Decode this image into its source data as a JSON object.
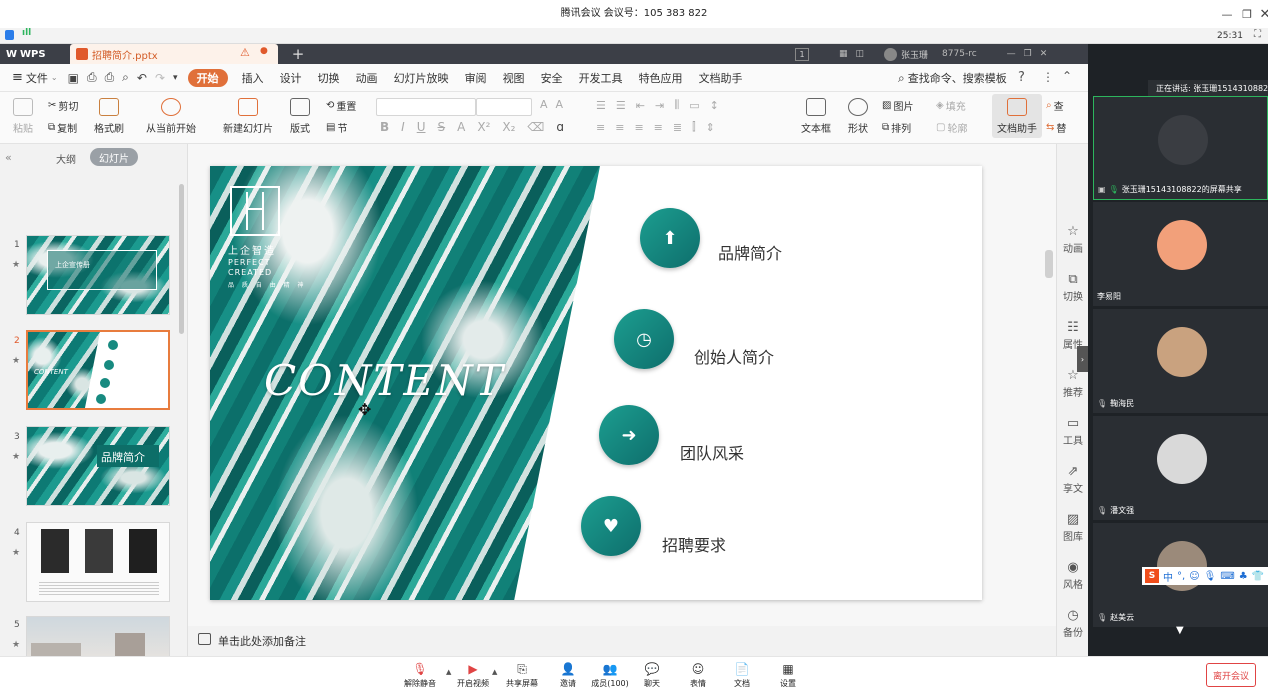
{
  "meeting": {
    "title": "腾讯会议 会议号：105 383 822",
    "signal_text": "ıll",
    "timer": "25:31",
    "speaking": "正在讲话: 张玉珊15143108822",
    "participants": [
      {
        "name": "张玉珊15143108822的屏幕共享",
        "avatar_color": "#3a3d42"
      },
      {
        "name": "李易阳",
        "avatar_color": "#f2a07a"
      },
      {
        "name": "鞠海民",
        "avatar_color": "#c9a27f"
      },
      {
        "name": "潘文强",
        "avatar_color": "#d9d9d9"
      },
      {
        "name": "赵美云",
        "avatar_color": "#9b8a7a"
      }
    ],
    "toolbar": [
      {
        "label": "解除静音",
        "icon": "mic-muted-icon"
      },
      {
        "label": "开启视频",
        "icon": "camera-off-icon"
      },
      {
        "label": "共享屏幕",
        "icon": "share-screen-icon"
      },
      {
        "label": "邀请",
        "icon": "invite-icon"
      },
      {
        "label": "成员(100)",
        "icon": "members-icon"
      },
      {
        "label": "聊天",
        "icon": "chat-icon"
      },
      {
        "label": "表情",
        "icon": "emoji-icon"
      },
      {
        "label": "文档",
        "icon": "document-icon"
      },
      {
        "label": "设置",
        "icon": "settings-icon"
      }
    ],
    "leave_label": "离开会议",
    "ime_label": "中"
  },
  "wps": {
    "app_label": "WPS",
    "doc_tab": "招聘简介.pptx",
    "tabbar_badge": "1",
    "user_label": "张玉珊",
    "user_id": "8775-rc",
    "file_menu": "文件",
    "menus": [
      "开始",
      "插入",
      "设计",
      "切换",
      "动画",
      "幻灯片放映",
      "审阅",
      "视图",
      "安全",
      "开发工具",
      "特色应用",
      "文档助手"
    ],
    "search_label": "查找命令、搜索模板",
    "ribbon": {
      "paste": "粘贴",
      "cut": "剪切",
      "copy": "复制",
      "format_painter": "格式刷",
      "play_from_current": "从当前开始",
      "new_slide": "新建幻灯片",
      "layout": "版式",
      "reset": "重置",
      "section": "节",
      "textbox": "文本框",
      "shape": "形状",
      "picture": "图片",
      "arrange": "排列",
      "fill": "填充",
      "outline": "轮廓",
      "doc_assistant": "文档助手",
      "find": "查",
      "replace": "替"
    },
    "panel": {
      "outline_tab": "大纲",
      "slides_tab": "幻灯片",
      "thumbnails": [
        {
          "num": "1",
          "label": "上企宣传册"
        },
        {
          "num": "2",
          "label": "CONTENT"
        },
        {
          "num": "3",
          "label": "品牌简介"
        },
        {
          "num": "4",
          "label": ""
        },
        {
          "num": "5",
          "label": ""
        }
      ]
    },
    "slide": {
      "heading": "CONTENT",
      "brand_name": "上企智造",
      "brand_en1": "PERFECT",
      "brand_en2": "CREATED",
      "brand_sub": "品 质 自 由 精 神",
      "agenda": [
        "品牌简介",
        "创始人简介",
        "团队风采",
        "招聘要求"
      ]
    },
    "notes_placeholder": "单击此处添加备注",
    "right_sidebar": [
      "动画",
      "切换",
      "属性",
      "推荐",
      "工具",
      "享文",
      "图库",
      "风格",
      "备份"
    ]
  }
}
